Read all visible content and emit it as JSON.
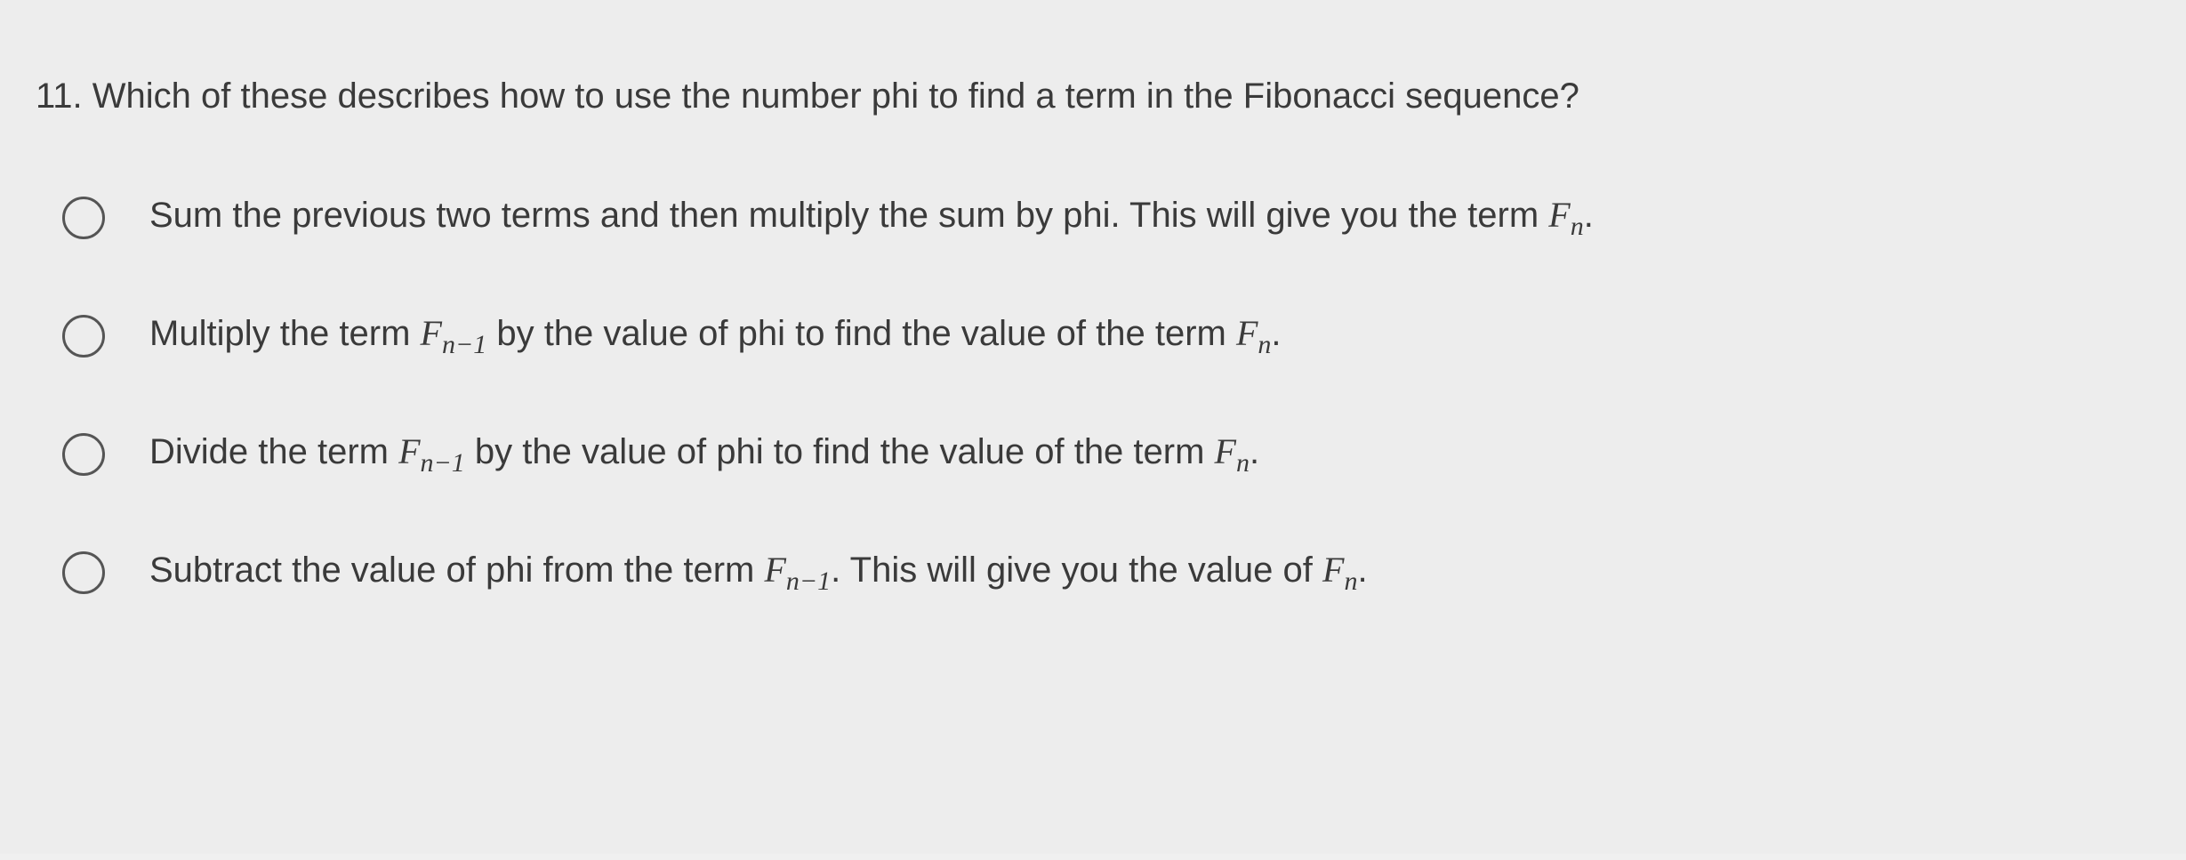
{
  "question": {
    "number": "11.",
    "text": "Which of these describes how to use the number phi to find a term in the Fibonacci sequence?"
  },
  "options": [
    {
      "id": "option-a",
      "prefix": "Sum the previous two terms and then multiply the sum by phi. This will give you the term ",
      "math_var": "F",
      "math_sub": "n",
      "suffix": "."
    },
    {
      "id": "option-b",
      "prefix": "Multiply the term ",
      "math_var1": "F",
      "math_sub1": "n−1",
      "mid": " by the value of phi to find the value of the term ",
      "math_var2": "F",
      "math_sub2": "n",
      "suffix": "."
    },
    {
      "id": "option-c",
      "prefix": "Divide the term ",
      "math_var1": "F",
      "math_sub1": "n−1",
      "mid": " by the value of phi to find the value of the term ",
      "math_var2": "F",
      "math_sub2": "n",
      "suffix": "."
    },
    {
      "id": "option-d",
      "prefix": "Subtract the value of phi from the term ",
      "math_var1": "F",
      "math_sub1": "n−1",
      "mid": ". This will give you the value of ",
      "math_var2": "F",
      "math_sub2": "n",
      "suffix": "."
    }
  ]
}
